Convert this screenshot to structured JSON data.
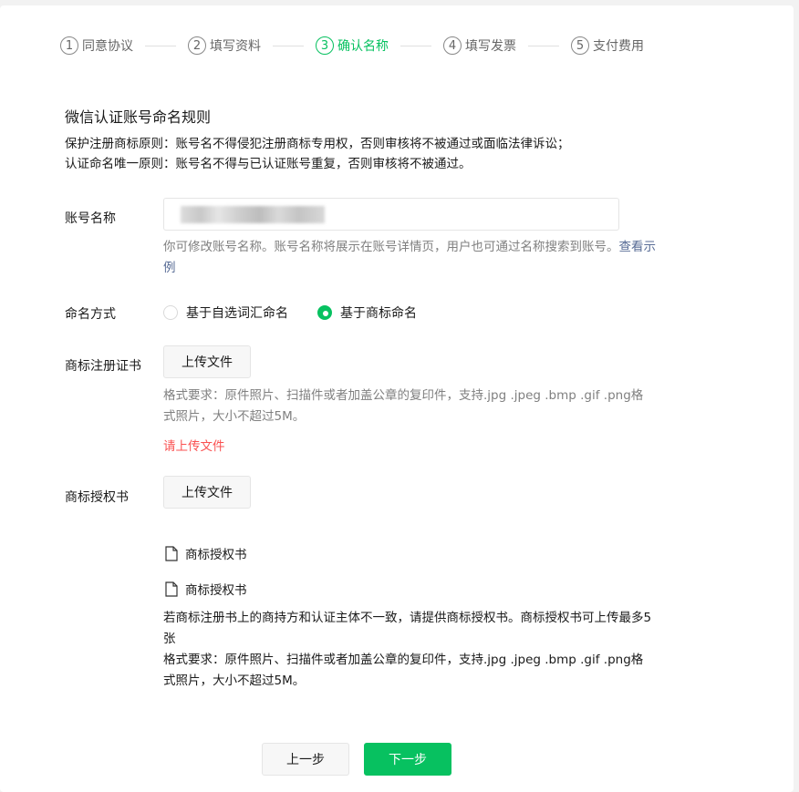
{
  "steps": [
    {
      "num": "1",
      "label": "同意协议"
    },
    {
      "num": "2",
      "label": "填写资料"
    },
    {
      "num": "3",
      "label": "确认名称"
    },
    {
      "num": "4",
      "label": "填写发票"
    },
    {
      "num": "5",
      "label": "支付费用"
    }
  ],
  "active_step": 3,
  "rules": {
    "title": "微信认证账号命名规则",
    "line1": "保护注册商标原则：账号名不得侵犯注册商标专用权，否则审核将不被通过或面临法律诉讼；",
    "line2": "认证命名唯一原则：账号名不得与已认证账号重复，否则审核将不被通过。"
  },
  "account_name": {
    "label": "账号名称",
    "hint": "你可修改账号名称。账号名称将展示在账号详情页，用户也可通过名称搜索到账号。",
    "hint_link": "查看示例"
  },
  "naming_method": {
    "label": "命名方式",
    "options": [
      "基于自选词汇命名",
      "基于商标命名"
    ],
    "selected": "基于商标命名"
  },
  "trademark_cert": {
    "label": "商标注册证书",
    "upload_label": "上传文件",
    "format_hint": "格式要求：原件照片、扫描件或者加盖公章的复印件，支持.jpg .jpeg .bmp .gif .png格式照片，大小不超过5M。",
    "error": "请上传文件"
  },
  "trademark_auth": {
    "label": "商标授权书",
    "upload_label": "上传文件",
    "files": [
      "商标授权书",
      "商标授权书"
    ],
    "note1": "若商标注册书上的商持方和认证主体不一致，请提供商标授权书。商标授权书可上传最多5张",
    "note2": "格式要求：原件照片、扫描件或者加盖公章的复印件，支持.jpg .jpeg .bmp .gif .png格式照片，大小不超过5M。"
  },
  "footer": {
    "prev": "上一步",
    "next": "下一步"
  },
  "colors": {
    "accent": "#07c160",
    "error": "#fa5151",
    "link": "#576b95"
  }
}
